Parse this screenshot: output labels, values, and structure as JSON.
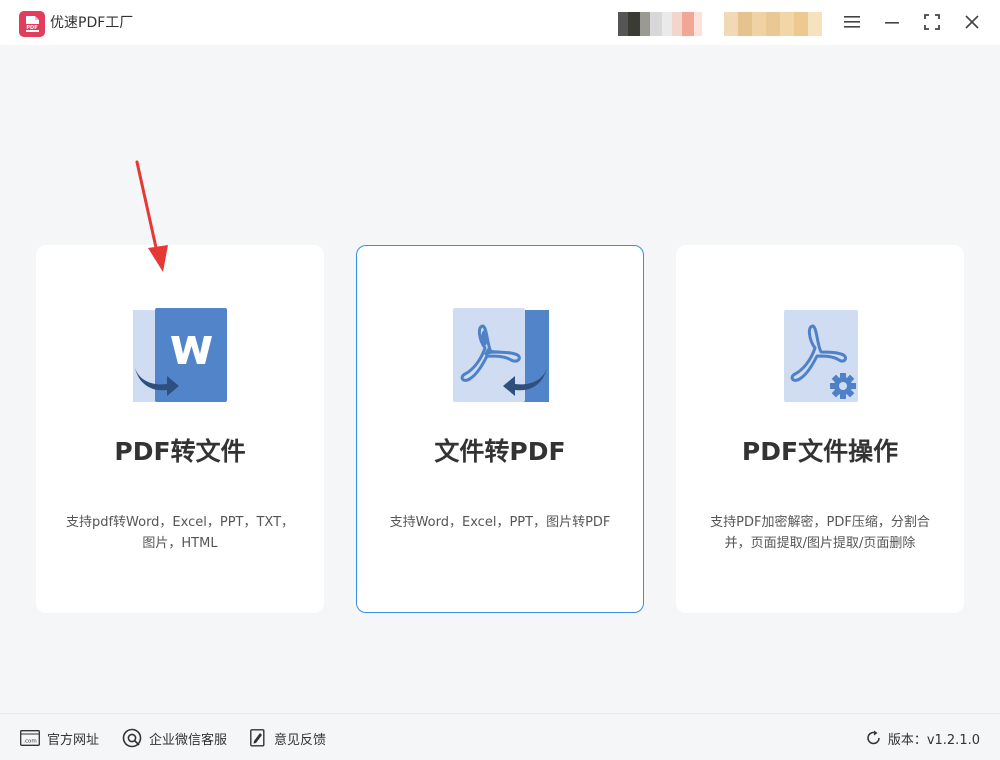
{
  "app": {
    "title": "优速PDF工厂",
    "logo_text": "PDF"
  },
  "colors": {
    "accent": "#3a8ee6",
    "icon_blue": "#4f81c7",
    "icon_light": "#cfdcf2",
    "logo_red": "#e03e5c",
    "arrow_red": "#e53935"
  },
  "cards": [
    {
      "title": "PDF转文件",
      "desc_line1": "支持pdf转Word，Excel，PPT，TXT，",
      "desc_line2": "图片，HTML",
      "icon": "pdf-to-word-icon"
    },
    {
      "title": "文件转PDF",
      "desc_line1": "支持Word，Excel，PPT，图片转PDF",
      "desc_line2": "",
      "icon": "file-to-pdf-icon"
    },
    {
      "title": "PDF文件操作",
      "desc_line1": "支持PDF加密解密，PDF压缩，分割合",
      "desc_line2": "并，页面提取/图片提取/页面删除",
      "icon": "pdf-tools-icon"
    }
  ],
  "footer": {
    "website": "官方网址",
    "wechat_service": "企业微信客服",
    "feedback": "意见反馈",
    "website_icon_text": ".com",
    "version_label": "版本：v1.2.1.0"
  }
}
